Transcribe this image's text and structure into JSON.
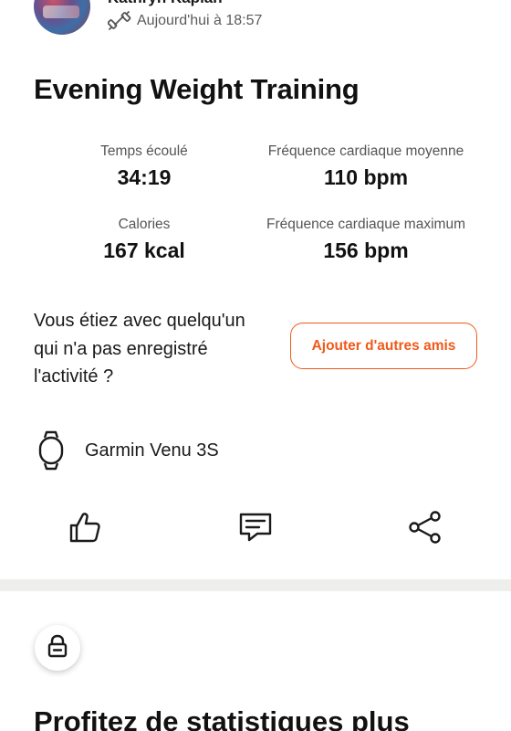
{
  "header": {
    "athlete_name": "Kathryn Kaplan",
    "timestamp": "Aujourd'hui à 18:57",
    "activity_icon": "dumbbell-icon"
  },
  "activity": {
    "title": "Evening Weight Training"
  },
  "stats": {
    "elapsed_label": "Temps écoulé",
    "elapsed_value": "34:19",
    "avg_hr_label": "Fréquence cardiaque moyenne",
    "avg_hr_value": "110 bpm",
    "calories_label": "Calories",
    "calories_value": "167 kcal",
    "max_hr_label": "Fréquence cardiaque maximum",
    "max_hr_value": "156 bpm"
  },
  "with_others": {
    "question": "Vous étiez avec quelqu'un qui n'a pas enregistré l'activité ?",
    "button_label": "Ajouter d'autres amis"
  },
  "device": {
    "icon": "watch-icon",
    "name": "Garmin Venu 3S"
  },
  "actions": [
    {
      "icon": "thumbs-up-icon"
    },
    {
      "icon": "comment-icon"
    },
    {
      "icon": "share-icon"
    }
  ],
  "promo": {
    "icon": "lock-icon",
    "title": "Profitez de statistiques plus"
  },
  "colors": {
    "accent": "#f05a1a",
    "text": "#1a1a1a",
    "muted": "#555555",
    "divider": "#eeeeec"
  }
}
